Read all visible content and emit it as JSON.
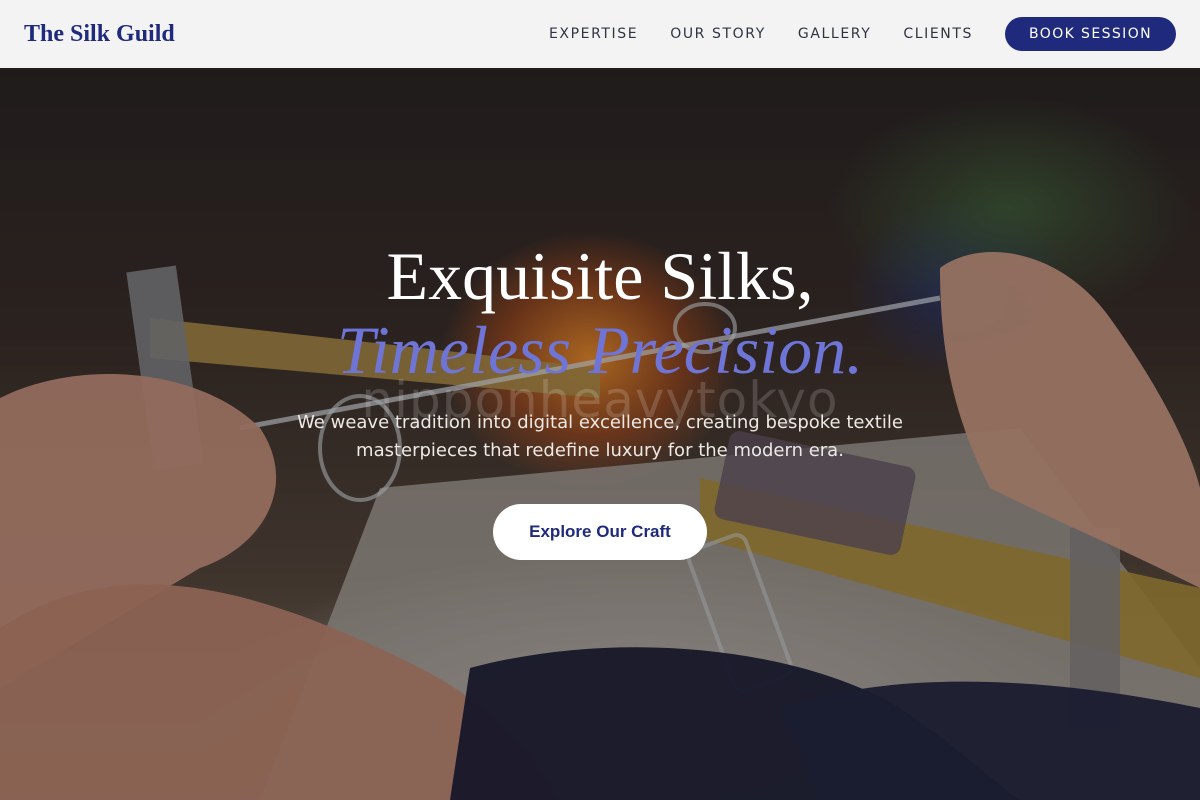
{
  "header": {
    "logo": "The Silk Guild",
    "nav": [
      "EXPERTISE",
      "OUR STORY",
      "GALLERY",
      "CLIENTS"
    ],
    "cta": "BOOK SESSION"
  },
  "hero": {
    "headline_line1": "Exquisite Silks,",
    "headline_line2": "Timeless Precision.",
    "watermark": "nipponheavytokyo",
    "subtitle": "We weave tradition into digital excellence, creating bespoke textile masterpieces that redefine luxury for the modern era.",
    "cta": "Explore Our Craft"
  },
  "colors": {
    "brand": "#1f2a7c",
    "accent_italic": "#6f75d6",
    "header_bg": "#f3f3f4"
  }
}
